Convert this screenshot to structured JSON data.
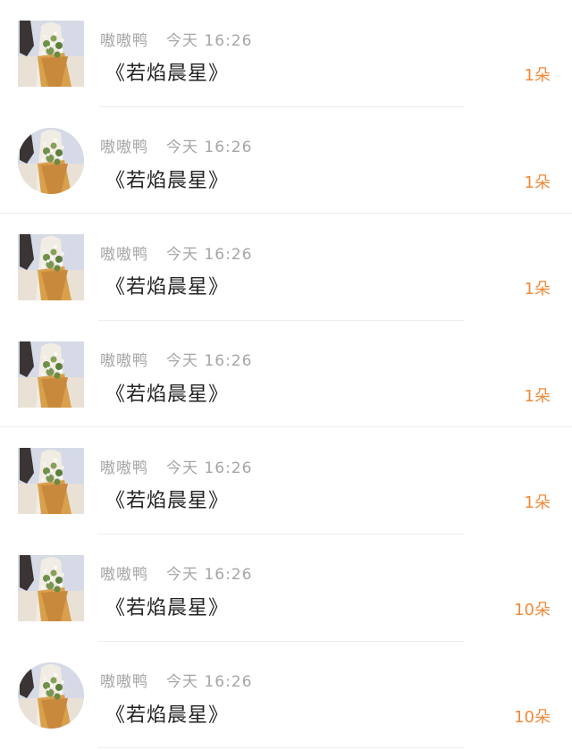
{
  "colors": {
    "username": "#a6a6a6",
    "title": "#222222",
    "gift_count": "#ef8a3a",
    "separator": "#eeeeee"
  },
  "rows": [
    {
      "avatar_icon": "avatar-flower-bouquet",
      "avatar_shape": "square",
      "username": "嗷嗷鸭",
      "time": "今天 16:26",
      "title": "《若焰晨星》",
      "count": "1朵"
    },
    {
      "avatar_icon": "avatar-flower-bouquet",
      "avatar_shape": "round",
      "username": "嗷嗷鸭",
      "time": "今天 16:26",
      "title": "《若焰晨星》",
      "count": "1朵"
    },
    {
      "avatar_icon": "avatar-flower-bouquet",
      "avatar_shape": "square",
      "username": "嗷嗷鸭",
      "time": "今天 16:26",
      "title": "《若焰晨星》",
      "count": "1朵"
    },
    {
      "avatar_icon": "avatar-flower-bouquet",
      "avatar_shape": "square",
      "username": "嗷嗷鸭",
      "time": "今天 16:26",
      "title": "《若焰晨星》",
      "count": "1朵"
    },
    {
      "avatar_icon": "avatar-flower-bouquet",
      "avatar_shape": "square",
      "username": "嗷嗷鸭",
      "time": "今天 16:26",
      "title": "《若焰晨星》",
      "count": "1朵"
    },
    {
      "avatar_icon": "avatar-flower-bouquet",
      "avatar_shape": "square",
      "username": "嗷嗷鸭",
      "time": "今天 16:26",
      "title": "《若焰晨星》",
      "count": "10朵"
    },
    {
      "avatar_icon": "avatar-flower-bouquet",
      "avatar_shape": "round",
      "username": "嗷嗷鸭",
      "time": "今天 16:26",
      "title": "《若焰晨星》",
      "count": "10朵"
    }
  ]
}
